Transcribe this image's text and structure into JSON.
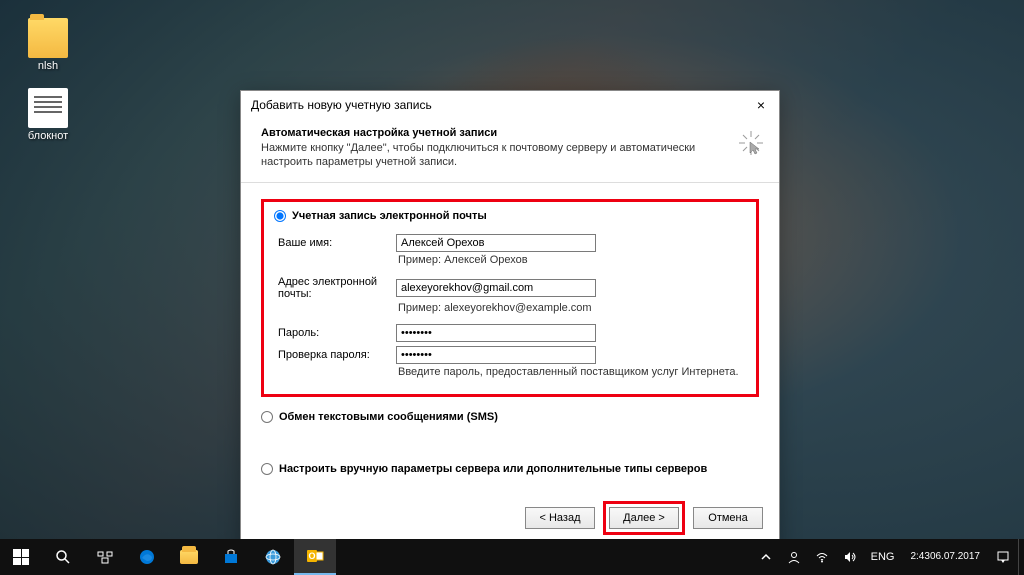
{
  "desktop": {
    "icons": [
      {
        "label": "nlsh"
      },
      {
        "label": "блокнот"
      }
    ]
  },
  "dialog": {
    "title": "Добавить новую учетную запись",
    "header_title": "Автоматическая настройка учетной записи",
    "header_sub": "Нажмите кнопку \"Далее\", чтобы подключиться к почтовому серверу и автоматически настроить параметры учетной записи.",
    "radio_email": "Учетная запись электронной почты",
    "radio_sms": "Обмен текстовыми сообщениями (SMS)",
    "radio_manual": "Настроить вручную параметры сервера или дополнительные типы серверов",
    "fields": {
      "name_label": "Ваше имя:",
      "name_value": "Алексей Орехов",
      "name_hint": "Пример: Алексей Орехов",
      "email_label": "Адрес электронной почты:",
      "email_value": "alexeyorekhov@gmail.com",
      "email_hint": "Пример: alexeyorekhov@example.com",
      "password_label": "Пароль:",
      "password_value": "********",
      "password2_label": "Проверка пароля:",
      "password2_value": "********",
      "password_hint": "Введите пароль, предоставленный поставщиком услуг Интернета."
    },
    "buttons": {
      "back": "< Назад",
      "next": "Далее >",
      "cancel": "Отмена"
    }
  },
  "taskbar": {
    "lang": "ENG",
    "time": "2:43",
    "date": "06.07.2017"
  }
}
